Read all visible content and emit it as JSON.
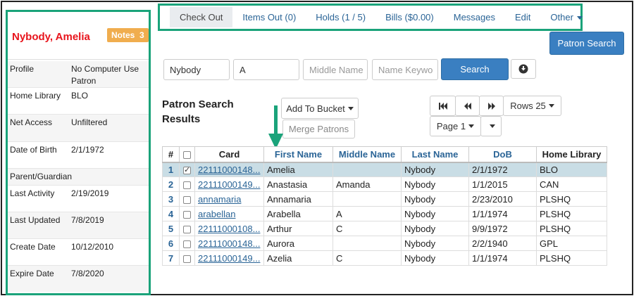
{
  "patron": {
    "name": "Nybody, Amelia",
    "notes_label": "Notes",
    "notes_count": "3",
    "fields": [
      {
        "label": "Profile",
        "value": "No Computer Use Patron"
      },
      {
        "label": "Home Library",
        "value": "BLO"
      },
      {
        "label": "Net Access",
        "value": "Unfiltered"
      },
      {
        "label": "Date of Birth",
        "value": "2/1/1972"
      },
      {
        "label": "Parent/Guardian",
        "value": ""
      },
      {
        "label": "Last Activity",
        "value": "2/19/2019"
      },
      {
        "label": "Last Updated",
        "value": "7/8/2019"
      },
      {
        "label": "Create Date",
        "value": "10/12/2010"
      },
      {
        "label": "Expire Date",
        "value": "7/8/2020"
      }
    ]
  },
  "nav": {
    "tabs": [
      "Check Out",
      "Items Out (0)",
      "Holds (1 / 5)",
      "Bills ($0.00)",
      "Messages",
      "Edit",
      "Other"
    ]
  },
  "patron_search_label": "Patron Search",
  "search": {
    "last_name": "Nybody",
    "first_name": "A",
    "middle_placeholder": "Middle Name",
    "keyword_placeholder": "Name Keywo",
    "search_label": "Search"
  },
  "results": {
    "title": "Patron Search Results",
    "add_to_bucket": "Add To Bucket",
    "merge_patrons": "Merge Patrons",
    "rows_label": "Rows 25",
    "page_label": "Page 1",
    "columns": [
      "#",
      "",
      "Card",
      "First Name",
      "Middle Name",
      "Last Name",
      "DoB",
      "Home Library"
    ],
    "rows": [
      {
        "num": "1",
        "checked": true,
        "card": "22111000148...",
        "first": "Amelia",
        "middle": "",
        "last": "Nybody",
        "dob": "2/1/1972",
        "lib": "BLO"
      },
      {
        "num": "2",
        "checked": false,
        "card": "22111000149...",
        "first": "Anastasia",
        "middle": "Amanda",
        "last": "Nybody",
        "dob": "1/1/2015",
        "lib": "CAN"
      },
      {
        "num": "3",
        "checked": false,
        "card": "annamaria",
        "first": "Annamaria",
        "middle": "",
        "last": "Nybody",
        "dob": "2/23/2010",
        "lib": "PLSHQ"
      },
      {
        "num": "4",
        "checked": false,
        "card": "arabellan",
        "first": "Arabella",
        "middle": "A",
        "last": "Nybody",
        "dob": "1/1/1974",
        "lib": "PLSHQ"
      },
      {
        "num": "5",
        "checked": false,
        "card": "22111000108...",
        "first": "Arthur",
        "middle": "C",
        "last": "Nybody",
        "dob": "9/9/1972",
        "lib": "PLSHQ"
      },
      {
        "num": "6",
        "checked": false,
        "card": "22111000148...",
        "first": "Aurora",
        "middle": "",
        "last": "Nybody",
        "dob": "2/2/1940",
        "lib": "GPL"
      },
      {
        "num": "7",
        "checked": false,
        "card": "22111000149...",
        "first": "Azelia",
        "middle": "C",
        "last": "Nybody",
        "dob": "1/1/1974",
        "lib": "PLSHQ"
      }
    ]
  },
  "colors": {
    "highlight": "#1aa37a",
    "patron_name": "#e8141c",
    "notes_badge": "#f0ad4e",
    "primary_button": "#3a7fc1"
  }
}
